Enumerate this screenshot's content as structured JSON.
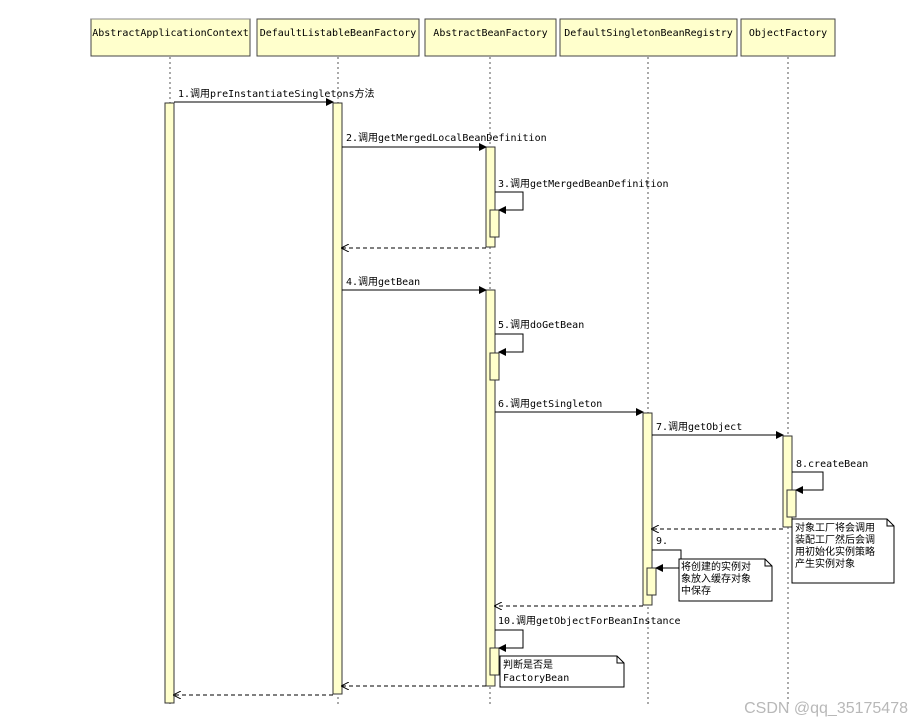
{
  "participants": [
    "AbstractApplicationContext",
    "DefaultListableBeanFactory",
    "AbstractBeanFactory",
    "DefaultSingletonBeanRegistry",
    "ObjectFactory"
  ],
  "messages": [
    "1.调用preInstantiateSingletons方法",
    "2.调用getMergedLocalBeanDefinition",
    "3.调用getMergedBeanDefinition",
    "4.调用getBean",
    "5.调用doGetBean",
    "6.调用getSingleton",
    "7.调用getObject",
    "8.createBean",
    "9.",
    "10.调用getObjectForBeanInstance"
  ],
  "notes": {
    "object_factory": [
      "对象工厂将会调用",
      "装配工厂然后会调",
      "用初始化实例策略",
      "产生实例对象"
    ],
    "cache": [
      "将创建的实例对",
      "象放入缓存对象",
      "中保存"
    ],
    "factory_bean": [
      "判断是否是",
      "FactoryBean"
    ]
  },
  "watermark": "CSDN @qq_35175478",
  "colors": {
    "participant_fill": "#ffffcc",
    "activation_fill": "#ffffcc",
    "line": "#333333",
    "watermark": "#b8b8b8"
  }
}
